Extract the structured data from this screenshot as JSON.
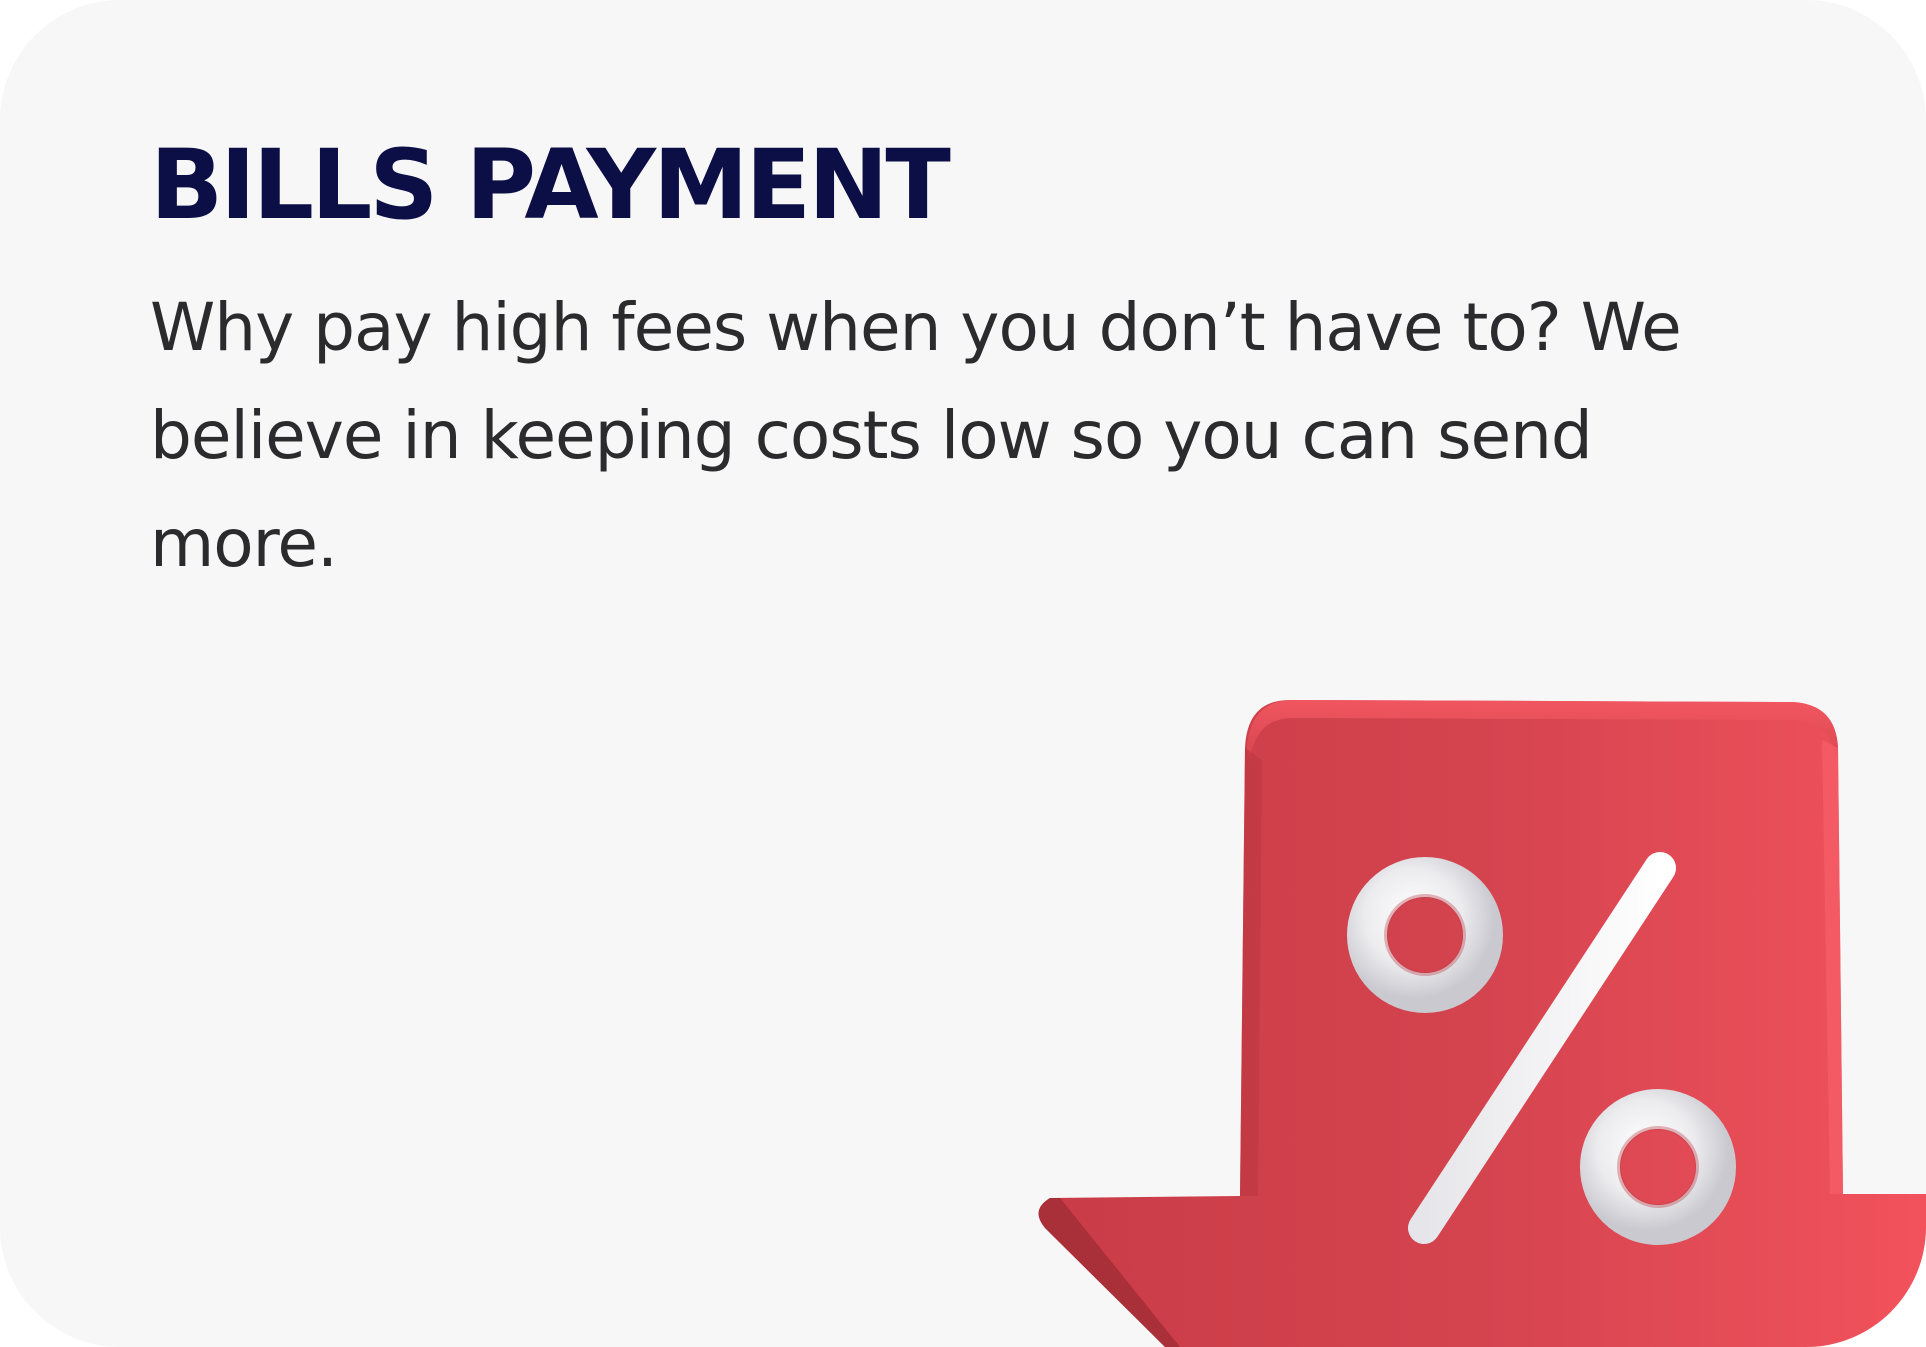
{
  "card": {
    "title": "BILLS PAYMENT",
    "description": "Why pay high fees when you don’t have to? We believe in keeping costs low so you can send more."
  },
  "illustration": {
    "icon": "percent-down-arrow-icon",
    "arrow_color": "#d9464f",
    "symbol_color": "#f1f1f3"
  },
  "colors": {
    "background": "#f7f7f7",
    "title": "#0c0e46",
    "text": "#2b2b2e"
  }
}
